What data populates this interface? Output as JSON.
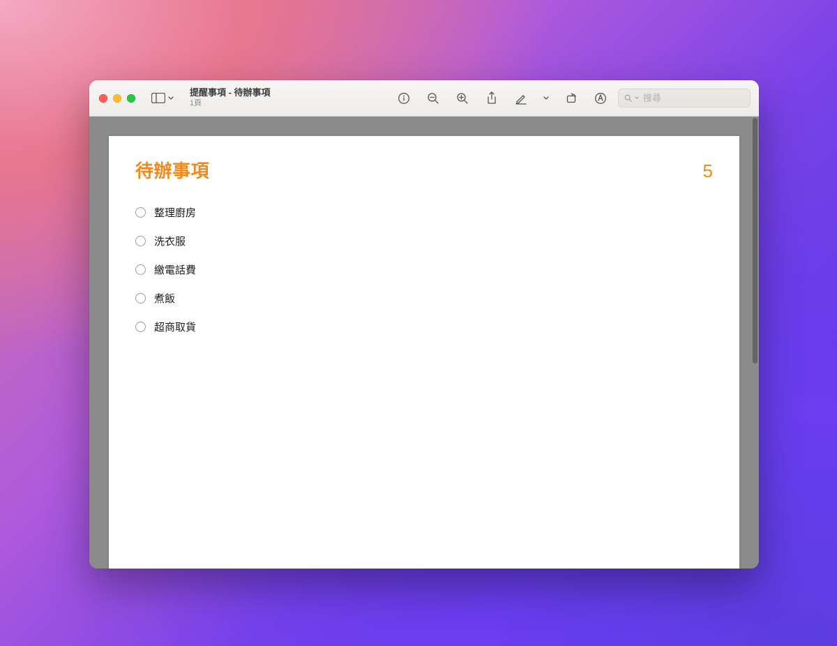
{
  "window": {
    "title": "提醒事項 - 待辦事項",
    "subtitle": "1頁"
  },
  "search": {
    "placeholder": "搜尋"
  },
  "document": {
    "title": "待辦事項",
    "count": "5",
    "items": [
      "整理廚房",
      "洗衣服",
      "繳電話費",
      "煮飯",
      "超商取貨"
    ]
  }
}
